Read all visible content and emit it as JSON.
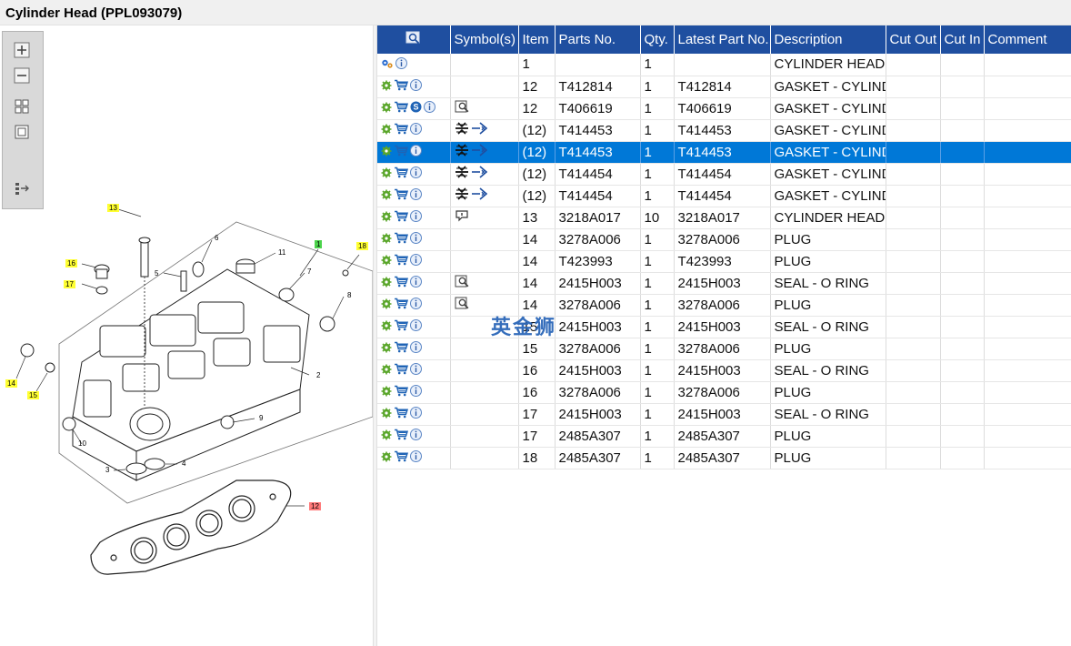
{
  "window": {
    "title": "Cylinder Head (PPL093079)"
  },
  "toolbar": {
    "items": [
      "zoom-in",
      "zoom-out",
      "fit-page",
      "actual-size",
      "toggle-list"
    ]
  },
  "diagram": {
    "callouts": [
      "13",
      "1",
      "18",
      "16",
      "17",
      "14",
      "15",
      "12",
      "6",
      "5",
      "11",
      "7",
      "8",
      "2",
      "9",
      "10",
      "3",
      "4"
    ]
  },
  "table": {
    "columns": [
      "",
      "Symbol(s)",
      "Item",
      "Parts No.",
      "Qty.",
      "Latest Part No.",
      "Description",
      "Cut Out",
      "Cut In",
      "Comment"
    ],
    "rows": [
      {
        "icons": [
          "gears",
          "info"
        ],
        "symbols": [],
        "item": "1",
        "part": "",
        "qty": "1",
        "latest": "",
        "desc": "CYLINDER HEAD A",
        "cutout": "",
        "cutin": "",
        "comment": ""
      },
      {
        "icons": [
          "gear",
          "cart",
          "info"
        ],
        "symbols": [],
        "item": "12",
        "part": "T412814",
        "qty": "1",
        "latest": "T412814",
        "desc": "GASKET - CYLINDE",
        "cutout": "",
        "cutin": "",
        "comment": ""
      },
      {
        "icons": [
          "gear",
          "cart",
          "s-badge",
          "info"
        ],
        "symbols": [
          "magnify-doc"
        ],
        "item": "12",
        "part": "T406619",
        "qty": "1",
        "latest": "T406619",
        "desc": "GASKET - CYLINDE",
        "cutout": "",
        "cutin": "",
        "comment": ""
      },
      {
        "icons": [
          "gear",
          "cart",
          "info"
        ],
        "symbols": [
          "split",
          "replace-arrow"
        ],
        "item": "(12)",
        "part": "T414453",
        "qty": "1",
        "latest": "T414453",
        "desc": "GASKET - CYLINDE",
        "cutout": "",
        "cutin": "",
        "comment": ""
      },
      {
        "icons": [
          "gear",
          "cart",
          "info"
        ],
        "symbols": [
          "split",
          "replace-arrow"
        ],
        "item": "(12)",
        "part": "T414453",
        "qty": "1",
        "latest": "T414453",
        "desc": "GASKET - CYLINDE",
        "cutout": "",
        "cutin": "",
        "comment": "",
        "selected": true
      },
      {
        "icons": [
          "gear",
          "cart",
          "info"
        ],
        "symbols": [
          "split",
          "replace-arrow"
        ],
        "item": "(12)",
        "part": "T414454",
        "qty": "1",
        "latest": "T414454",
        "desc": "GASKET - CYLINDE",
        "cutout": "",
        "cutin": "",
        "comment": ""
      },
      {
        "icons": [
          "gear",
          "cart",
          "info"
        ],
        "symbols": [
          "split",
          "replace-arrow"
        ],
        "item": "(12)",
        "part": "T414454",
        "qty": "1",
        "latest": "T414454",
        "desc": "GASKET - CYLINDE",
        "cutout": "",
        "cutin": "",
        "comment": ""
      },
      {
        "icons": [
          "gear",
          "cart",
          "info"
        ],
        "symbols": [
          "speech-bubble"
        ],
        "item": "13",
        "part": "3218A017",
        "qty": "10",
        "latest": "3218A017",
        "desc": "CYLINDER HEAD B",
        "cutout": "",
        "cutin": "",
        "comment": ""
      },
      {
        "icons": [
          "gear",
          "cart",
          "info"
        ],
        "symbols": [],
        "item": "14",
        "part": "3278A006",
        "qty": "1",
        "latest": "3278A006",
        "desc": "PLUG",
        "cutout": "",
        "cutin": "",
        "comment": ""
      },
      {
        "icons": [
          "gear",
          "cart",
          "info"
        ],
        "symbols": [],
        "item": "14",
        "part": "T423993",
        "qty": "1",
        "latest": "T423993",
        "desc": "PLUG",
        "cutout": "",
        "cutin": "",
        "comment": ""
      },
      {
        "icons": [
          "gear",
          "cart",
          "info"
        ],
        "symbols": [
          "magnify-doc"
        ],
        "item": "14",
        "part": "2415H003",
        "qty": "1",
        "latest": "2415H003",
        "desc": "SEAL - O RING",
        "cutout": "",
        "cutin": "",
        "comment": ""
      },
      {
        "icons": [
          "gear",
          "cart",
          "info"
        ],
        "symbols": [
          "magnify-doc"
        ],
        "item": "14",
        "part": "3278A006",
        "qty": "1",
        "latest": "3278A006",
        "desc": "PLUG",
        "cutout": "",
        "cutin": "",
        "comment": ""
      },
      {
        "icons": [
          "gear",
          "cart",
          "info"
        ],
        "symbols": [],
        "item": "15",
        "part": "2415H003",
        "qty": "1",
        "latest": "2415H003",
        "desc": "SEAL - O RING",
        "cutout": "",
        "cutin": "",
        "comment": ""
      },
      {
        "icons": [
          "gear",
          "cart",
          "info"
        ],
        "symbols": [],
        "item": "15",
        "part": "3278A006",
        "qty": "1",
        "latest": "3278A006",
        "desc": "PLUG",
        "cutout": "",
        "cutin": "",
        "comment": ""
      },
      {
        "icons": [
          "gear",
          "cart",
          "info"
        ],
        "symbols": [],
        "item": "16",
        "part": "2415H003",
        "qty": "1",
        "latest": "2415H003",
        "desc": "SEAL - O RING",
        "cutout": "",
        "cutin": "",
        "comment": ""
      },
      {
        "icons": [
          "gear",
          "cart",
          "info"
        ],
        "symbols": [],
        "item": "16",
        "part": "3278A006",
        "qty": "1",
        "latest": "3278A006",
        "desc": "PLUG",
        "cutout": "",
        "cutin": "",
        "comment": ""
      },
      {
        "icons": [
          "gear",
          "cart",
          "info"
        ],
        "symbols": [],
        "item": "17",
        "part": "2415H003",
        "qty": "1",
        "latest": "2415H003",
        "desc": "SEAL - O RING",
        "cutout": "",
        "cutin": "",
        "comment": ""
      },
      {
        "icons": [
          "gear",
          "cart",
          "info"
        ],
        "symbols": [],
        "item": "17",
        "part": "2485A307",
        "qty": "1",
        "latest": "2485A307",
        "desc": "PLUG",
        "cutout": "",
        "cutin": "",
        "comment": ""
      },
      {
        "icons": [
          "gear",
          "cart",
          "info"
        ],
        "symbols": [],
        "item": "18",
        "part": "2485A307",
        "qty": "1",
        "latest": "2485A307",
        "desc": "PLUG",
        "cutout": "",
        "cutin": "",
        "comment": ""
      }
    ]
  },
  "watermark": {
    "text": "英金狮"
  },
  "colors": {
    "header": "#1f4fa0",
    "selected": "#0078d7",
    "gear": "#5aa62a",
    "cart": "#1f63b5",
    "info": "#5b86c5",
    "callout_yellow": "#ffff33",
    "callout_green": "#4cd44c",
    "callout_red": "#ff7a7a"
  }
}
